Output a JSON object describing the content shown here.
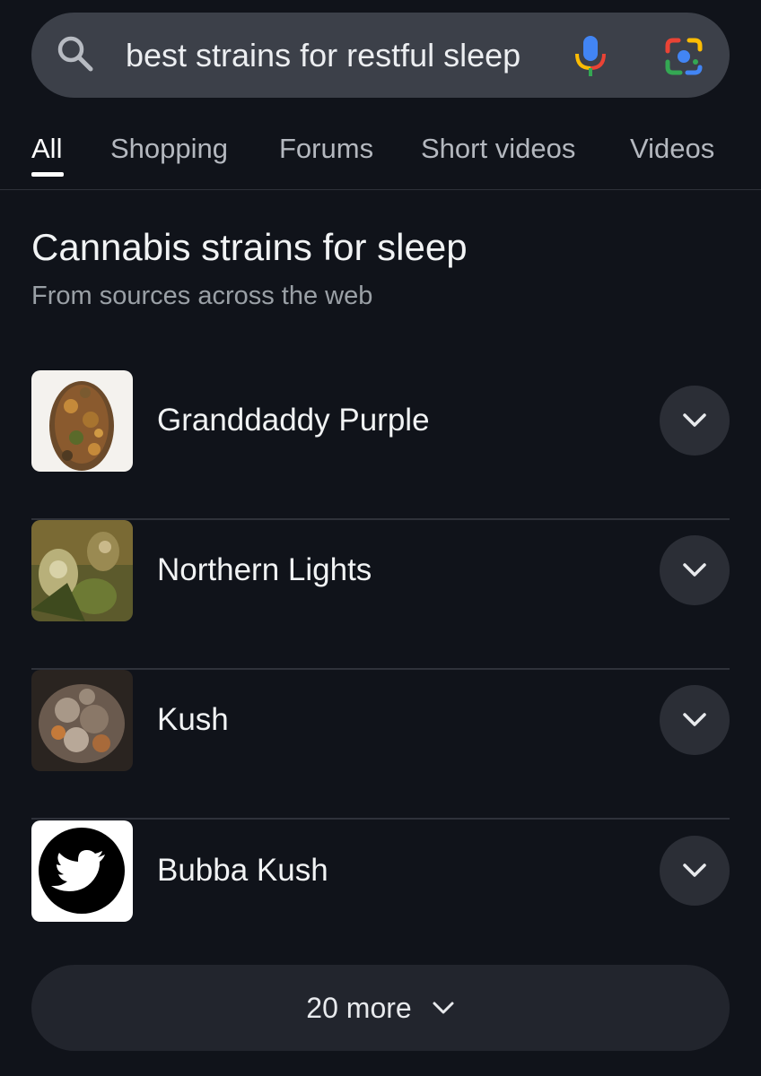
{
  "search": {
    "query": "best strains for restful sleep"
  },
  "tabs": [
    {
      "label": "All",
      "active": true
    },
    {
      "label": "Shopping",
      "active": false
    },
    {
      "label": "Forums",
      "active": false
    },
    {
      "label": "Short videos",
      "active": false
    },
    {
      "label": "Videos",
      "active": false
    }
  ],
  "section": {
    "title": "Cannabis strains for sleep",
    "subtitle": "From sources across the web"
  },
  "items": [
    {
      "label": "Granddaddy Purple",
      "thumb": "cannabis-bud-photo"
    },
    {
      "label": "Northern Lights",
      "thumb": "cannabis-plant-photo"
    },
    {
      "label": "Kush",
      "thumb": "cannabis-bud-photo"
    },
    {
      "label": "Bubba Kush",
      "thumb": "twitter-logo"
    }
  ],
  "more": {
    "label": "20 more"
  },
  "colors": {
    "background": "#10131a",
    "search_bar": "#3c4049",
    "chevron_button": "#2b2e36",
    "more_button": "#22252d",
    "google_blue": "#4285f4",
    "google_red": "#ea4335",
    "google_yellow": "#fbbc04",
    "google_green": "#34a853"
  }
}
